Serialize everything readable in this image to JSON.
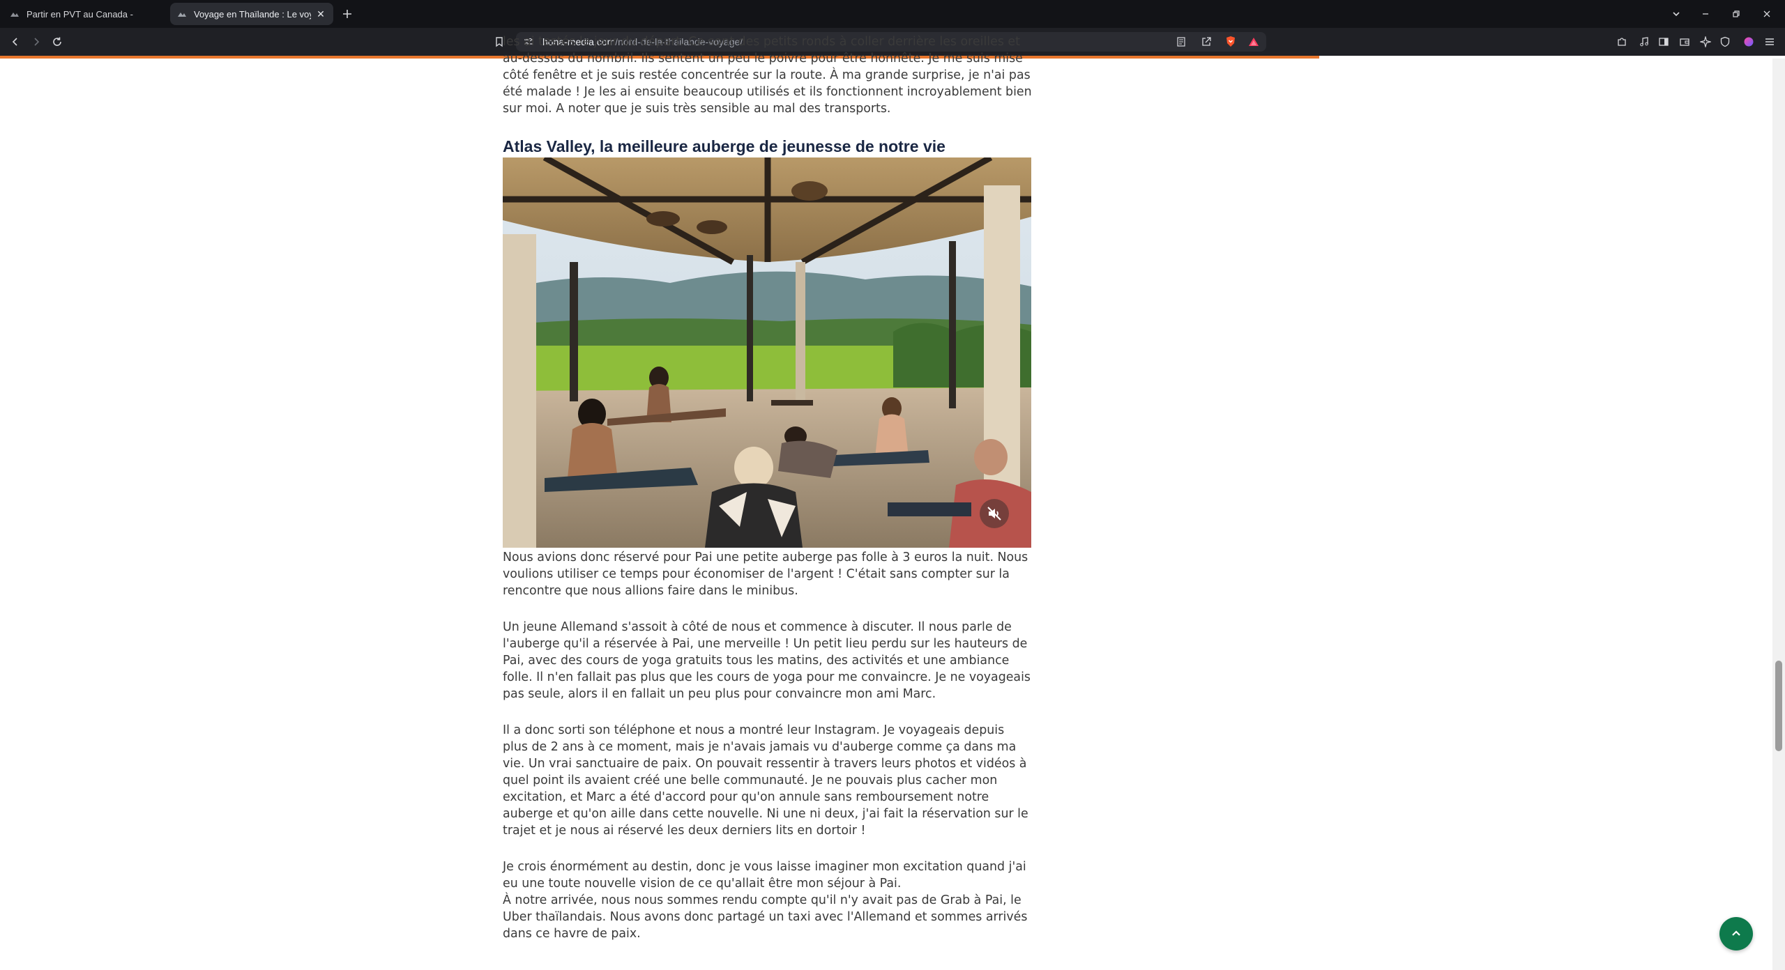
{
  "browser": {
    "tabs": [
      {
        "title": "Partir en PVT au Canada -",
        "active": false
      },
      {
        "title": "Voyage en Thaïlande : Le voyage",
        "active": true
      }
    ],
    "new_tab_icon": "plus-icon",
    "url_host": "hona-media.com",
    "url_path": "/nord-de-la-thailande-voyage/"
  },
  "colors": {
    "accent_progress": "#e8772e",
    "back_to_top": "#0e7a4c",
    "heading": "#1a2743"
  },
  "article": {
    "intro_paragraph": "les ai testés le jour du départ. Ce sont des petits ronds à coller derrière les oreilles et au-dessus du nombril. Ils sentent un peu le poivre pour être honnête. Je me suis mise côté fenêtre et je suis restée concentrée sur la route. À ma grande surprise, je n'ai pas été malade ! Je les ai ensuite beaucoup utilisés et ils fonctionnent incroyablement bien sur moi. A noter que je suis très sensible au mal des transports.",
    "heading": "Atlas Valley, la meilleure auberge de jeunesse de notre vie",
    "paragraphs": [
      "Nous avions donc réservé pour Pai une petite auberge pas folle à 3 euros la nuit. Nous voulions utiliser ce temps pour économiser de l'argent ! C'était sans compter sur la rencontre que nous allions faire dans le minibus.",
      "Un jeune Allemand s'assoit à côté de nous et commence à discuter. Il nous parle de l'auberge qu'il a réservée à Pai, une merveille ! Un petit lieu perdu sur les hauteurs de Pai, avec des cours de yoga gratuits tous les matins, des activités et une ambiance folle. Il n'en fallait pas plus que les cours de yoga pour me convaincre. Je ne voyageais pas seule, alors il en fallait un peu plus pour convaincre mon ami Marc.",
      "Il a donc sorti son téléphone et nous a montré leur Instagram. Je voyageais depuis plus de 2 ans à ce moment, mais je n'avais jamais vu d'auberge comme ça dans ma vie. Un vrai sanctuaire de paix. On pouvait ressentir à travers leurs photos et vidéos à quel point ils avaient créé une belle communauté. Je ne pouvais plus cacher mon excitation, et Marc a été d'accord pour qu'on annule sans remboursement notre auberge et qu'on aille dans cette nouvelle. Ni une ni deux, j'ai fait la réservation sur le trajet et je nous ai réservé les deux derniers lits en dortoir !"
    ],
    "last_paragraph_line1": "Je crois énormément au destin, donc je vous laisse imaginer mon excitation quand j'ai eu une toute nouvelle vision de ce qu'allait être mon séjour à Pai.",
    "last_paragraph_line2": "À notre arrivée, nous nous sommes rendu compte qu'il n'y avait pas de Grab à Pai, le Uber thaïlandais. Nous avons donc partagé un taxi avec l'Allemand et sommes arrivés dans ce havre de paix."
  }
}
